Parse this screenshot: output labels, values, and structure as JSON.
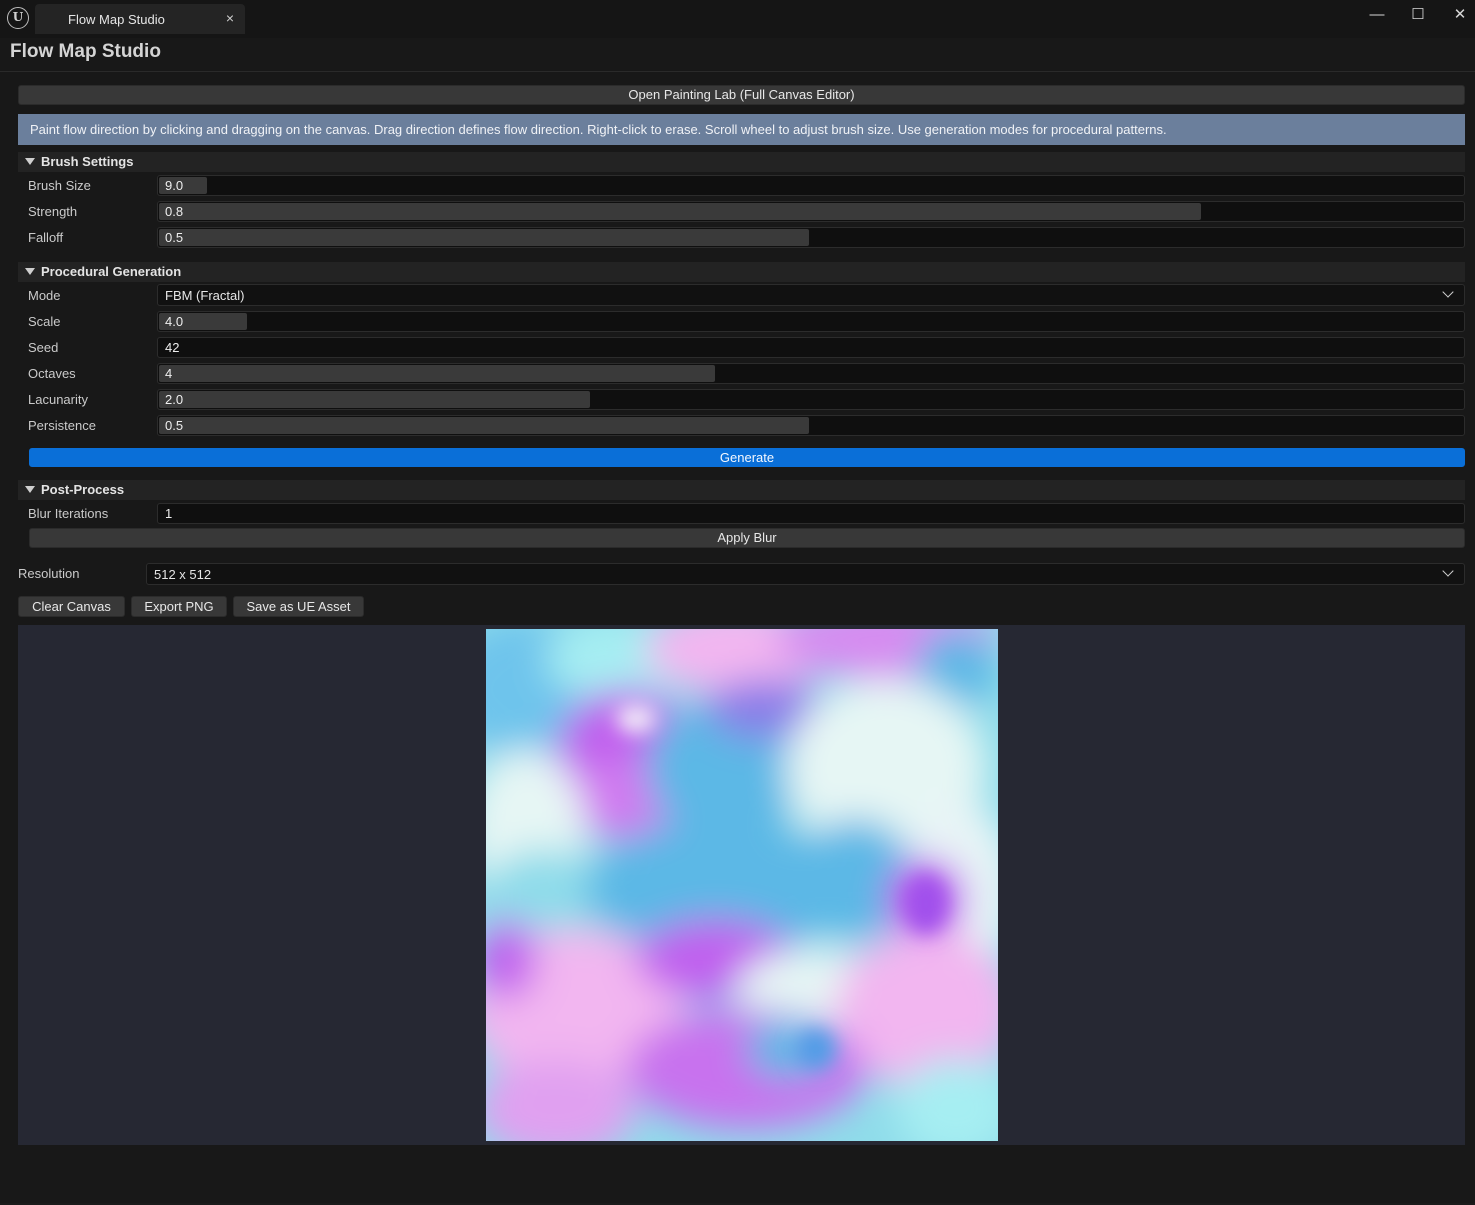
{
  "window": {
    "tab_title": "Flow Map Studio",
    "tab_close": "×",
    "controls": {
      "minimize": "—",
      "maximize": "☐",
      "close": "✕"
    }
  },
  "header": {
    "title": "Flow Map Studio"
  },
  "toolbar": {
    "open_painting_lab": "Open Painting Lab (Full Canvas Editor)"
  },
  "info": {
    "text": "Paint flow direction by clicking and dragging on the canvas. Drag direction defines flow direction. Right-click to erase. Scroll wheel to adjust brush size. Use generation modes for procedural patterns."
  },
  "brush_settings": {
    "title": "Brush Settings",
    "brush_size": {
      "label": "Brush Size",
      "value": "9.0"
    },
    "strength": {
      "label": "Strength",
      "value": "0.8"
    },
    "falloff": {
      "label": "Falloff",
      "value": "0.5"
    }
  },
  "procedural": {
    "title": "Procedural Generation",
    "mode": {
      "label": "Mode",
      "value": "FBM (Fractal)"
    },
    "scale": {
      "label": "Scale",
      "value": "4.0"
    },
    "seed": {
      "label": "Seed",
      "value": "42"
    },
    "octaves": {
      "label": "Octaves",
      "value": "4"
    },
    "lacunarity": {
      "label": "Lacunarity",
      "value": "2.0"
    },
    "persistence": {
      "label": "Persistence",
      "value": "0.5"
    },
    "generate_label": "Generate"
  },
  "post_process": {
    "title": "Post-Process",
    "blur_iterations": {
      "label": "Blur Iterations",
      "value": "1"
    },
    "apply_blur_label": "Apply Blur"
  },
  "resolution": {
    "label": "Resolution",
    "value": "512 x 512"
  },
  "actions": {
    "clear_canvas": "Clear Canvas",
    "export_png": "Export PNG",
    "save_asset": "Save as UE Asset"
  },
  "colors": {
    "accent": "#0a6fd8",
    "info_bar": "#6b7f9c",
    "flow_cyan": "#8fdcea",
    "flow_blue": "#5bb8e6",
    "flow_magenta": "#c060ee",
    "flow_pink": "#f2b6f0",
    "flow_white": "#e6f6f4"
  }
}
